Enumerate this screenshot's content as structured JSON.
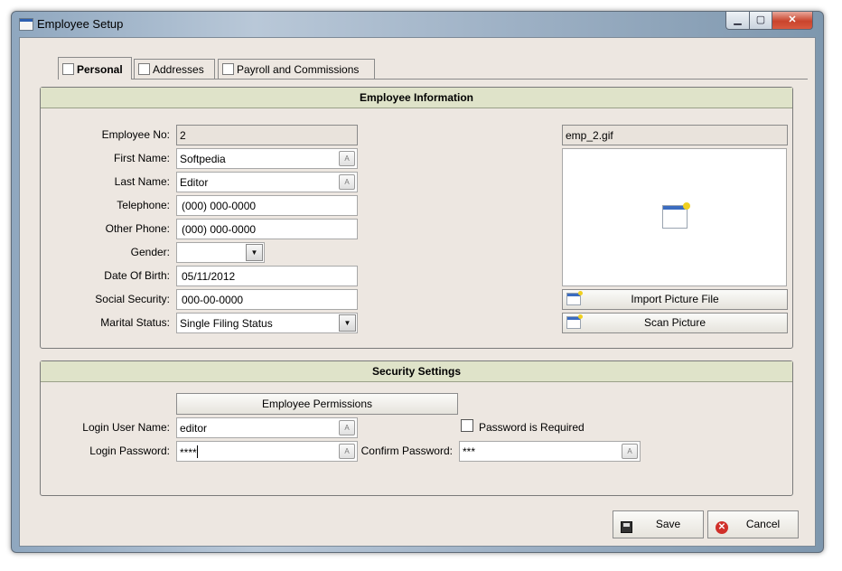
{
  "window": {
    "title": "Employee Setup",
    "minimize_glyph": "▁",
    "maximize_glyph": "▢",
    "close_glyph": "✕"
  },
  "tabs": [
    {
      "label": "Personal",
      "active": true
    },
    {
      "label": "Addresses",
      "active": false
    },
    {
      "label": "Payroll and Commissions",
      "active": false
    }
  ],
  "employee_info": {
    "header": "Employee Information",
    "fields": {
      "employee_no": {
        "label": "Employee No:",
        "value": "2"
      },
      "first_name": {
        "label": "First Name:",
        "value": "Softpedia"
      },
      "last_name": {
        "label": "Last Name:",
        "value": "Editor"
      },
      "telephone": {
        "label": "Telephone:",
        "value": "(000) 000-0000"
      },
      "other_phone": {
        "label": "Other Phone:",
        "value": "(000) 000-0000"
      },
      "gender": {
        "label": "Gender:",
        "value": ""
      },
      "date_of_birth": {
        "label": "Date Of Birth:",
        "value": "05/11/2012"
      },
      "social_security": {
        "label": "Social Security:",
        "value": "000-00-0000"
      },
      "marital_status": {
        "label": "Marital Status:",
        "value": "Single Filing Status"
      }
    },
    "picture": {
      "filename": "emp_2.gif",
      "import_label": "Import Picture File",
      "scan_label": "Scan Picture"
    },
    "lookup_glyph": "A",
    "dropdown_glyph": "▼"
  },
  "security": {
    "header": "Security Settings",
    "permissions_label": "Employee Permissions",
    "login_user_name": {
      "label": "Login User Name:",
      "value": "editor"
    },
    "login_password": {
      "label": "Login Password:",
      "value": "****"
    },
    "confirm_password": {
      "label": "Confirm Password:",
      "value": "***"
    },
    "password_required": {
      "label": "Password is Required",
      "checked": false
    }
  },
  "actions": {
    "save_label": "Save",
    "cancel_label": "Cancel",
    "cancel_glyph": "✕"
  }
}
